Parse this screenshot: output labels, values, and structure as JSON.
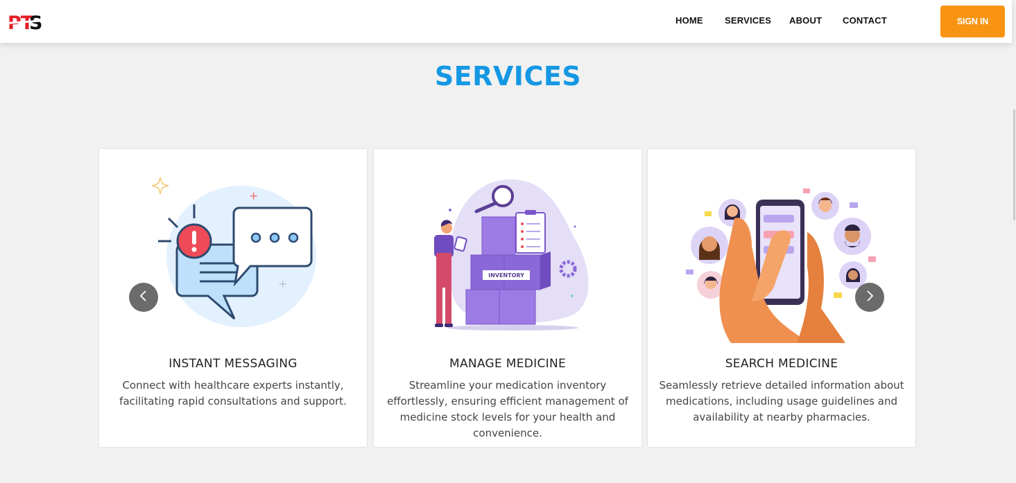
{
  "header": {
    "logo_text": "PTS",
    "nav": [
      "HOME",
      "SERVICES",
      "ABOUT",
      "CONTACT"
    ],
    "signin_label": "SIGN IN",
    "accent_color": "#f89412"
  },
  "section": {
    "title": "SERVICES",
    "title_color": "#1598e4"
  },
  "cards": [
    {
      "icon": "chat-alert-illustration",
      "title": "INSTANT MESSAGING",
      "description": "Connect with healthcare experts instantly, facilitating rapid consultations and support."
    },
    {
      "icon": "inventory-illustration",
      "title": "MANAGE MEDICINE",
      "inventory_label": "INVENTORY",
      "description": "Streamline your medication inventory effortlessly, ensuring efficient management of medicine stock levels for your health and convenience."
    },
    {
      "icon": "phone-search-illustration",
      "title": "SEARCH MEDICINE",
      "description": "Seamlessly retrieve detailed information about medications, including usage guidelines and availability at nearby pharmacies."
    }
  ],
  "carousel": {
    "prev_icon": "chevron-left-icon",
    "next_icon": "chevron-right-icon"
  }
}
